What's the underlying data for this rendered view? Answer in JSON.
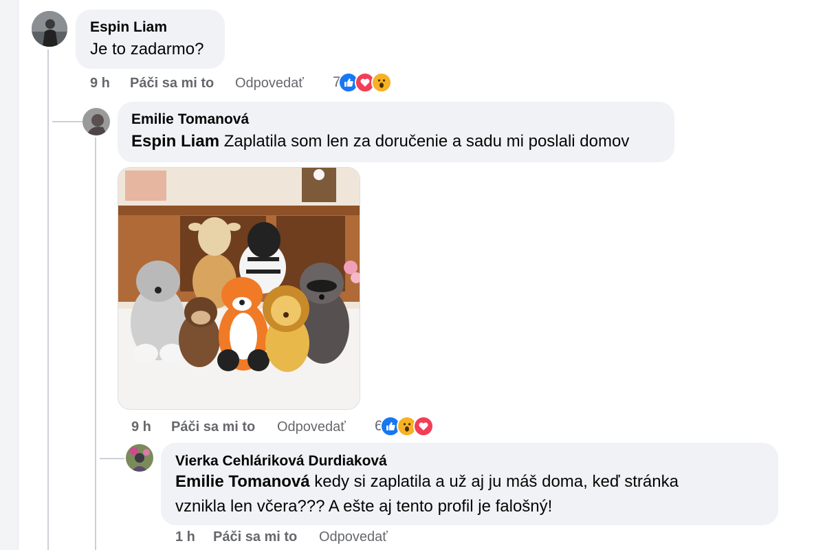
{
  "comments": [
    {
      "author": "Espin Liam",
      "text": "Je to zadarmo?",
      "time": "9 h",
      "like_label": "Páči sa mi to",
      "reply_label": "Odpovedať",
      "reaction_count": "7",
      "reactions": [
        "like-icon",
        "love-icon",
        "wow-icon"
      ]
    },
    {
      "author": "Emilie Tomanová",
      "mention": "Espin Liam",
      "text": " Zaplatila som len za doručenie a sadu mi poslali domov",
      "time": "9 h",
      "like_label": "Páči sa mi to",
      "reply_label": "Odpovedať",
      "reaction_count": "6",
      "reactions": [
        "like-icon",
        "wow-icon",
        "love-icon"
      ]
    },
    {
      "author": "Vierka Cehláriková Durdiaková",
      "mention": "Emilie Tomanová",
      "text_line1": " kedy si zaplatila a už aj ju máš doma, keď stránka",
      "text_line2": "vznikla len včera??? A ešte aj tento profil je falošný!",
      "time": "1 h",
      "like_label": "Páči sa mi to",
      "reply_label": "Odpovedať"
    }
  ],
  "colors": {
    "bubble": "#f0f2f5",
    "like": "#1877f2",
    "love": "#f33e58",
    "wow": "#f7b125",
    "meta_text": "#65676b"
  }
}
